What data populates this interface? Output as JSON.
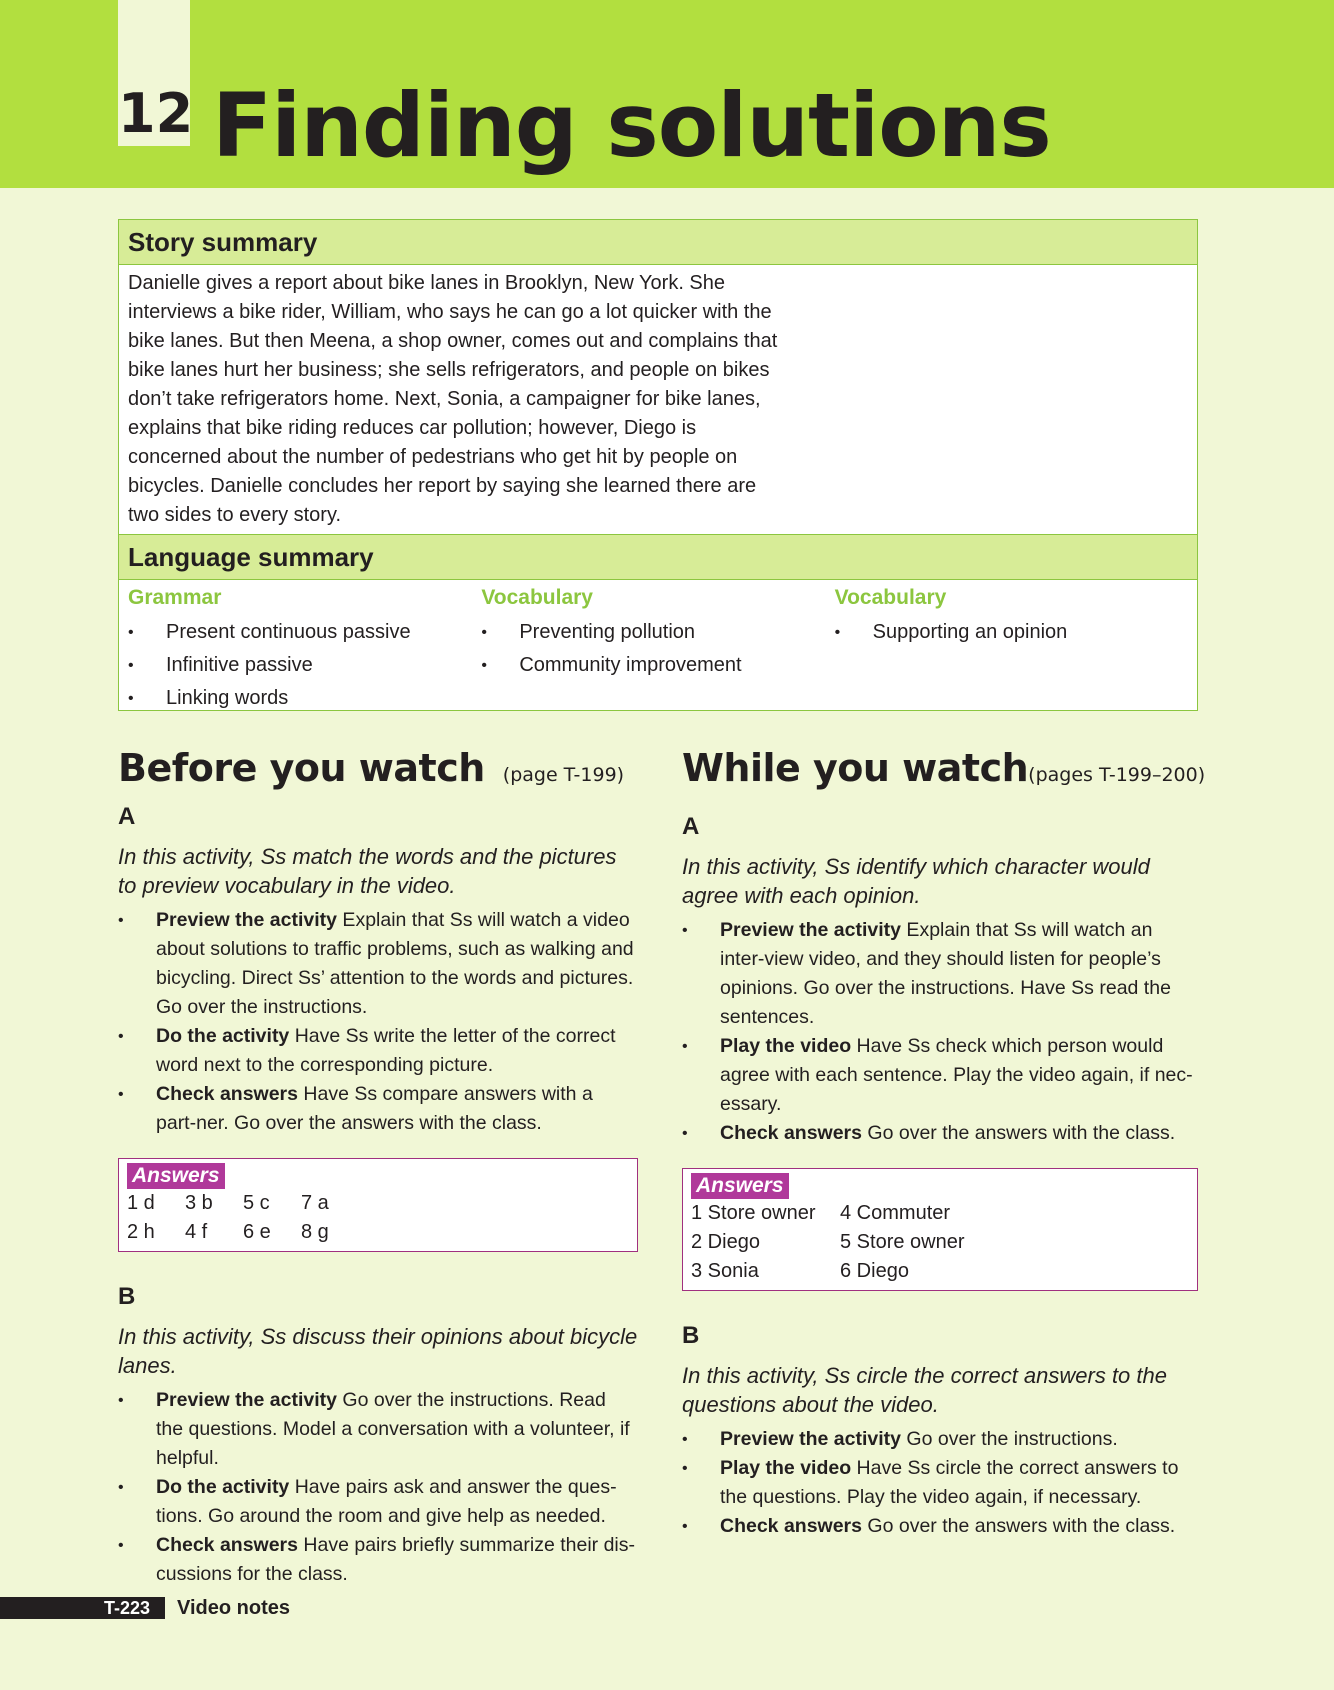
{
  "header": {
    "unit_number": "12",
    "title": "Finding solutions"
  },
  "story_summary": {
    "heading": "Story summary",
    "text": "Danielle gives a report about bike lanes in Brooklyn, New York. She interviews a bike rider, William, who says he can go a lot quicker with the bike lanes. But then Meena, a shop owner, comes out and complains that bike lanes hurt her business; she sells refrigerators, and people on bikes don’t take refrigerators home. Next, Sonia, a campaigner for bike lanes, explains that bike riding reduces car pollution; however, Diego is concerned about the number of pedestrians who get hit by people on bicycles. Danielle concludes her report by saying she learned there are two sides to every story."
  },
  "language_summary": {
    "heading": "Language summary",
    "columns": [
      {
        "heading": "Grammar",
        "items": [
          "Present continuous passive",
          "Infinitive passive",
          "Linking words"
        ]
      },
      {
        "heading": "Vocabulary",
        "items": [
          "Preventing pollution",
          "Community improvement"
        ]
      },
      {
        "heading": "Vocabulary",
        "items": [
          "Supporting an opinion"
        ]
      }
    ]
  },
  "before": {
    "title": "Before you watch",
    "page_ref": "(page T-199)",
    "a": {
      "letter": "A",
      "intro": "In this activity, Ss match the words and the pictures to preview vocabulary in the video.",
      "steps": [
        {
          "label": "Preview the activity",
          "text": " Explain that Ss will watch a video about solutions to traffic problems, such as walking and bicycling. Direct Ss’ attention to the words and pictures. Go over the instructions."
        },
        {
          "label": "Do the activity",
          "text": " Have Ss write the letter of the correct word next to the corresponding picture."
        },
        {
          "label": "Check answers",
          "text": " Have Ss compare answers with a part-ner. Go over the answers with the class."
        }
      ],
      "answers_label": "Answers",
      "answers_rows": [
        [
          "1 d",
          "3 b",
          "5 c",
          "7 a"
        ],
        [
          "2 h",
          "4 f",
          "6 e",
          "8 g"
        ]
      ]
    },
    "b": {
      "letter": "B",
      "intro": "In this activity, Ss discuss their opinions about bicycle lanes.",
      "steps": [
        {
          "label": "Preview the activity",
          "text": " Go over the instructions. Read the questions. Model a conversation with a volunteer, if helpful."
        },
        {
          "label": "Do the activity",
          "text": " Have pairs ask and answer the ques-tions. Go around the room and give help as needed."
        },
        {
          "label": "Check answers",
          "text": " Have pairs briefly summarize their dis-cussions for the class."
        }
      ]
    }
  },
  "while": {
    "title": "While you watch",
    "page_ref": "(pages T-199–200)",
    "a": {
      "letter": "A",
      "intro": "In this activity, Ss identify which character would agree with each opinion.",
      "steps": [
        {
          "label": "Preview the activity",
          "text": " Explain that Ss will watch an inter-view video, and they should listen for people’s opinions. Go over the instructions. Have Ss read the sentences."
        },
        {
          "label": "Play the video",
          "text": " Have Ss check which person would agree with each sentence. Play the video again, if nec-essary."
        },
        {
          "label": "Check answers",
          "text": " Go over the answers with the class."
        }
      ],
      "answers_label": "Answers",
      "answers_rows": [
        [
          "1 Store owner",
          "4 Commuter"
        ],
        [
          "2 Diego",
          "5 Store owner"
        ],
        [
          "3 Sonia",
          "6 Diego"
        ]
      ]
    },
    "b": {
      "letter": "B",
      "intro": "In this activity, Ss circle the correct answers to the questions about the video.",
      "steps": [
        {
          "label": "Preview the activity",
          "text": " Go over the instructions."
        },
        {
          "label": "Play the video",
          "text": " Have Ss circle the correct answers to the questions. Play the video again, if necessary."
        },
        {
          "label": "Check answers",
          "text": " Go over the answers with the class."
        }
      ]
    }
  },
  "footer": {
    "page_number": "T-223",
    "label": "Video notes"
  },
  "colors": {
    "header_green": "#b2df3f",
    "page_bg": "#f1f7d6",
    "box_head_green": "#d7ec97",
    "vocab_green": "#8cc63f",
    "answers_magenta": "#b0399a"
  }
}
